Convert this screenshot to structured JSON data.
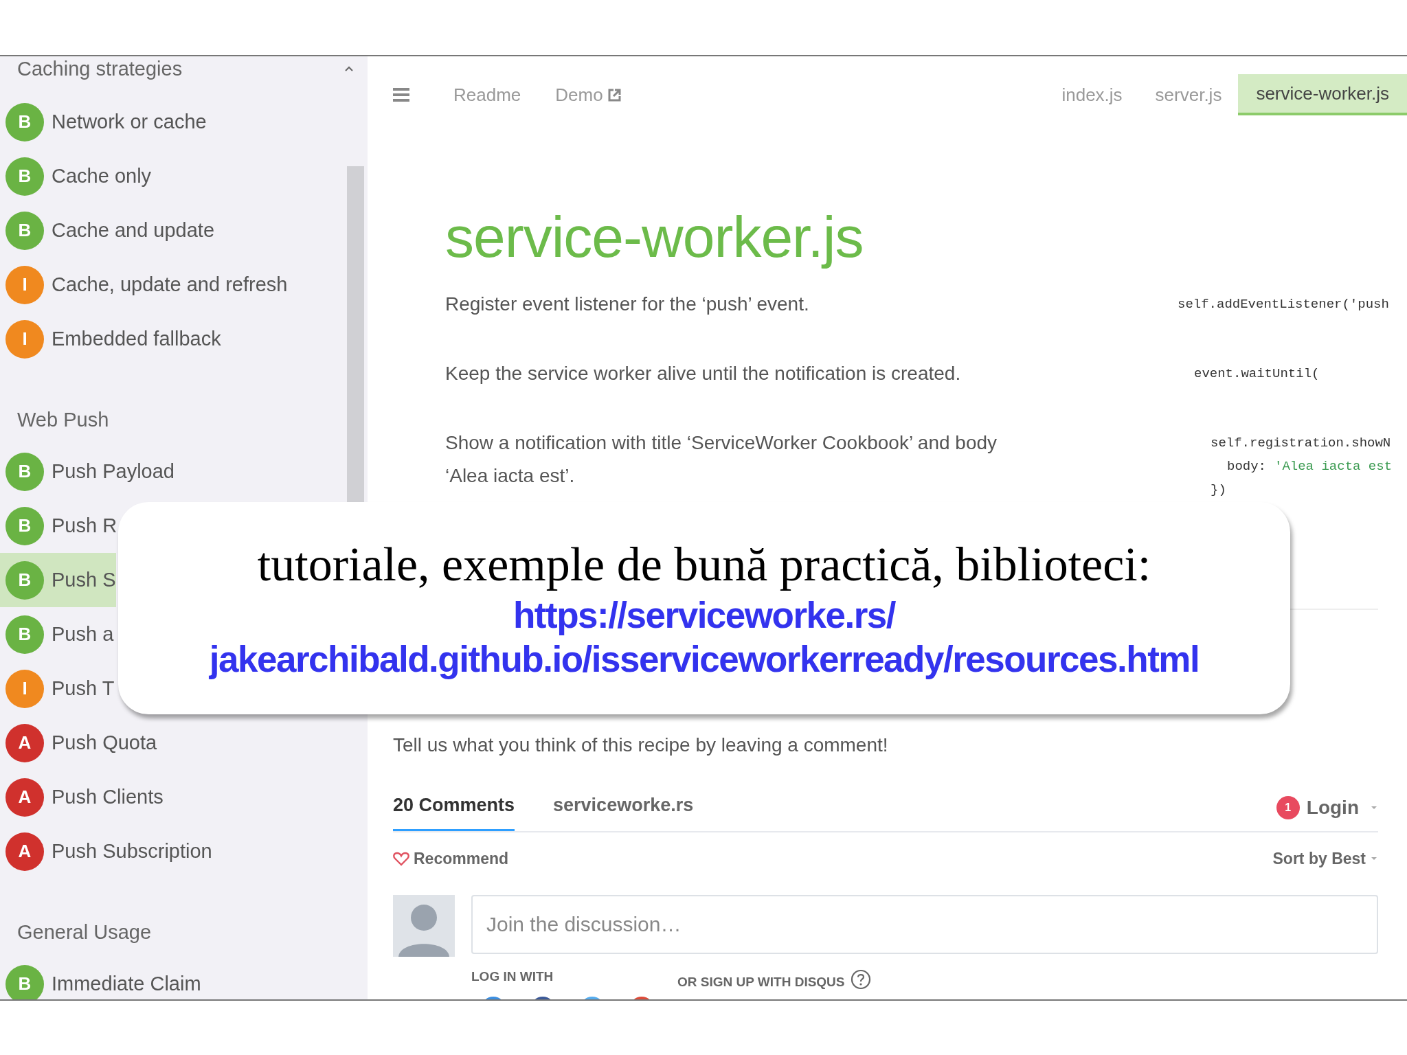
{
  "sidebar": {
    "groups": [
      {
        "title": "Caching strategies",
        "items": [
          {
            "badge": "B",
            "color": "#6ab344",
            "label": "Network or cache",
            "selected": false
          },
          {
            "badge": "B",
            "color": "#6ab344",
            "label": "Cache only",
            "selected": false
          },
          {
            "badge": "B",
            "color": "#6ab344",
            "label": "Cache and update",
            "selected": false
          },
          {
            "badge": "I",
            "color": "#f0891f",
            "label": "Cache, update and refresh",
            "selected": false
          },
          {
            "badge": "I",
            "color": "#f0891f",
            "label": "Embedded fallback",
            "selected": false
          }
        ]
      },
      {
        "title": "Web Push",
        "items": [
          {
            "badge": "B",
            "color": "#6ab344",
            "label": "Push Payload",
            "selected": false
          },
          {
            "badge": "B",
            "color": "#6ab344",
            "label": "Push R",
            "selected": false
          },
          {
            "badge": "B",
            "color": "#6ab344",
            "label": "Push S",
            "selected": true
          },
          {
            "badge": "B",
            "color": "#6ab344",
            "label": "Push a",
            "selected": false
          },
          {
            "badge": "I",
            "color": "#f0891f",
            "label": "Push T",
            "selected": false
          },
          {
            "badge": "A",
            "color": "#d0312d",
            "label": "Push Quota",
            "selected": false
          },
          {
            "badge": "A",
            "color": "#d0312d",
            "label": "Push Clients",
            "selected": false
          },
          {
            "badge": "A",
            "color": "#d0312d",
            "label": "Push Subscription",
            "selected": false
          }
        ]
      },
      {
        "title": "General Usage",
        "items": [
          {
            "badge": "B",
            "color": "#6ab344",
            "label": "Immediate Claim",
            "selected": false
          }
        ]
      }
    ]
  },
  "toolbar": {
    "links": [
      {
        "label": "Readme",
        "external": false
      },
      {
        "label": "Demo",
        "external": true
      }
    ],
    "file_tabs": [
      {
        "label": "index.js",
        "selected": false
      },
      {
        "label": "server.js",
        "selected": false
      },
      {
        "label": "service-worker.js",
        "selected": true
      }
    ]
  },
  "article": {
    "title": "service-worker.js",
    "steps": [
      {
        "text": "Register event listener for the ‘push’ event.",
        "code": [
          {
            "code": "self.addEventListener('push"
          }
        ]
      },
      {
        "text": "Keep the service worker alive until the notification is created.",
        "code": [
          {
            "code": "event.waitUntil("
          }
        ]
      },
      {
        "text": "Show a notification with title ‘ServiceWorker Cookbook’ and body ‘Alea iacta est’.",
        "code": [
          {
            "code": "self.registration.showN",
            "children": [
              {
                "code": "body:",
                "string": "'Alea iacta est"
              }
            ]
          },
          {
            "code": "})"
          }
        ]
      }
    ]
  },
  "comments": {
    "prompt": "Tell us what you think of this recipe by leaving a comment!",
    "tabs": [
      {
        "label": "20 Comments",
        "selected": true
      },
      {
        "label": "serviceworke.rs",
        "selected": false
      }
    ],
    "notification_count": "1",
    "login": "Login",
    "recommend": "Recommend",
    "sort": "Sort by Best",
    "input": {
      "placeholder": "Join the discussion…"
    },
    "login_with": "LOG IN WITH",
    "signup": "OR SIGN UP WITH DISQUS"
  },
  "callout": {
    "heading": "tutoriale, exemple de bună practică, biblioteci:",
    "links": [
      "https://serviceworke.rs/",
      "jakearchibald.github.io/isserviceworkerready/resources.html"
    ]
  }
}
